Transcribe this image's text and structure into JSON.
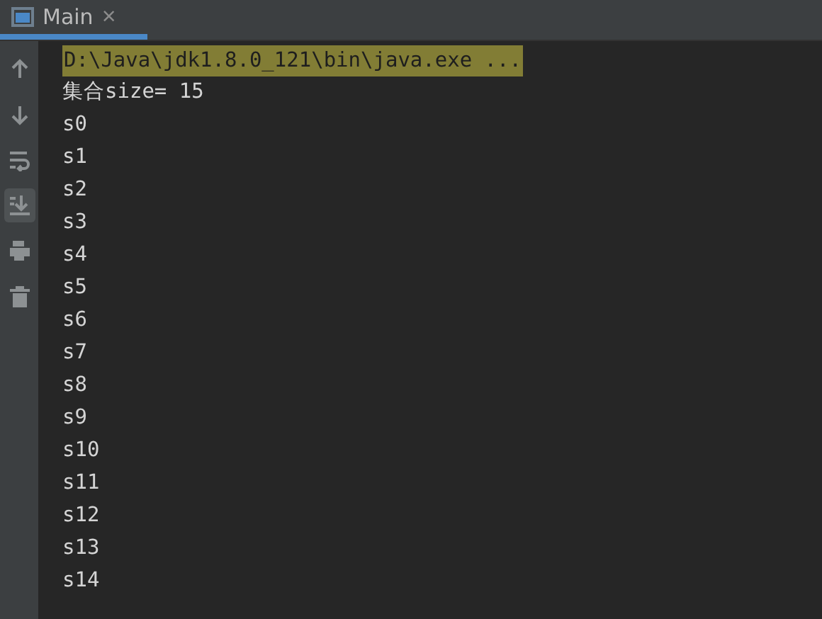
{
  "tab": {
    "label": "Main",
    "close": "×",
    "selected": true
  },
  "tools": [
    {
      "kind": "up",
      "selected": false
    },
    {
      "kind": "down",
      "selected": false
    },
    {
      "kind": "wrap",
      "selected": false
    },
    {
      "kind": "scroll",
      "selected": true
    },
    {
      "kind": "print",
      "selected": false
    },
    {
      "kind": "trash",
      "selected": false
    }
  ],
  "console": {
    "command": "D:\\Java\\jdk1.8.0_121\\bin\\java.exe ...",
    "lines": [
      "集合size= 15",
      "s0",
      "s1",
      "s2",
      "s3",
      "s4",
      "s5",
      "s6",
      "s7",
      "s8",
      "s9",
      "s10",
      "s11",
      "s12",
      "s13",
      "s14"
    ]
  }
}
